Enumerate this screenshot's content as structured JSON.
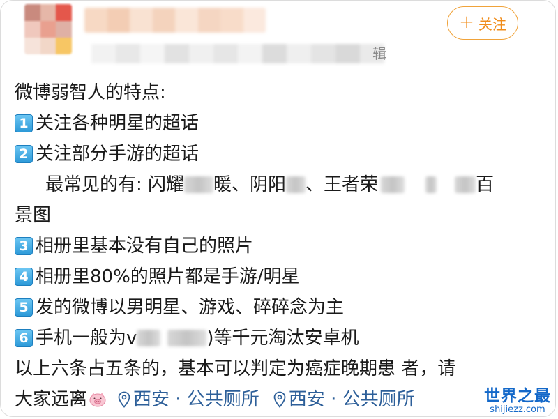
{
  "header": {
    "follow_label": "关注",
    "meta_tail": "辑"
  },
  "post": {
    "title": "微博弱智人的特点:",
    "item1": {
      "badge": "1",
      "text": "关注各种明星的超话"
    },
    "item2": {
      "badge": "2",
      "text": "关注部分手游的超话"
    },
    "common_prefix": "最常见的有: 闪耀",
    "common_mid1": "暖、阴阳",
    "common_mid2": "、王者荣",
    "common_end": "百",
    "common_wrap": "景图",
    "item3": {
      "badge": "3",
      "text": "相册里基本没有自己的照片"
    },
    "item4": {
      "badge": "4",
      "text": "相册里80%的照片都是手游/明星"
    },
    "item5": {
      "badge": "5",
      "text": "发的微博以男明星、游戏、碎碎念为主"
    },
    "item6": {
      "badge": "6",
      "prefix": "手机一般为v",
      "suffix": ")等千元淘汰安卓机"
    },
    "conclusion": "以上六条占五条的，基本可以判定为癌症晚期患 者，请",
    "last_line": "大家远离",
    "locations": [
      "西安 · 公共厕所",
      "西安 · 公共厕所"
    ]
  },
  "watermark": {
    "brand": "世界之最",
    "domain": "shijiezz.com"
  },
  "colors": {
    "accent_orange": "#f08c1a",
    "link_blue": "#2d5f99",
    "watermark_blue": "#1368c9",
    "badge_blue": "#2d9ad8"
  }
}
